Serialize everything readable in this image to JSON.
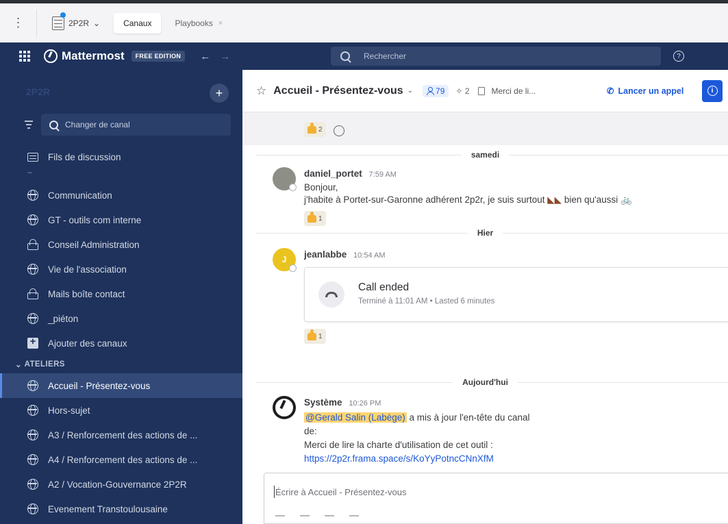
{
  "tabbar": {
    "team": "2P2R",
    "tabs": [
      {
        "label": "Canaux",
        "active": true
      },
      {
        "label": "Playbooks",
        "active": false,
        "close": "×"
      }
    ]
  },
  "global_header": {
    "product": "Mattermost",
    "edition_badge": "FREE EDITION",
    "back_icon": "←",
    "forward_icon": "→",
    "search_placeholder": "Rechercher",
    "help_icon": "?"
  },
  "sidebar": {
    "team_name": "2P2R",
    "add_icon": "+",
    "find_channel": "Changer de canal",
    "items": [
      {
        "label": "Fils de discussion",
        "icon": "threads-icon"
      },
      {
        "label": "Communication",
        "icon": "globe-icon"
      },
      {
        "label": "GT - outils com interne",
        "icon": "globe-icon"
      },
      {
        "label": "Conseil Administration",
        "icon": "lock-icon"
      },
      {
        "label": "Vie de l'association",
        "icon": "globe-icon"
      },
      {
        "label": "Mails boîte contact",
        "icon": "lock-icon"
      },
      {
        "label": "_piéton",
        "icon": "globe-icon"
      },
      {
        "label": "Ajouter des canaux",
        "icon": "add-box-icon"
      }
    ],
    "category": "ATELIERS",
    "category_items": [
      {
        "label": "Accueil - Présentez-vous",
        "active": true
      },
      {
        "label": "Hors-sujet"
      },
      {
        "label": "A3 / Renforcement des actions de ..."
      },
      {
        "label": "A4 / Renforcement des actions de ..."
      },
      {
        "label": "A2 / Vocation-Gouvernance 2P2R"
      },
      {
        "label": "Evenement Transtoulousaine"
      }
    ]
  },
  "channel_header": {
    "name": "Accueil - Présentez-vous",
    "member_count": "79",
    "pinned_count": "2",
    "purpose": "Merci de li...",
    "call_button": "Lancer un appel"
  },
  "messages": {
    "top_reaction": {
      "count": "2"
    },
    "separators": [
      "samedi",
      "Hier",
      "Aujourd'hui"
    ],
    "post1": {
      "author": "daniel_portet",
      "time": "7:59 AM",
      "lines": [
        "Bonjour,",
        "j'habite à Portet-sur-Garonne adhérent 2p2r, je suis surtout",
        "bien qu'aussi"
      ],
      "reaction_count": "1"
    },
    "post2": {
      "author": "jeanlabbe",
      "avatar_letter": "J",
      "time": "10:54 AM",
      "call_title": "Call ended",
      "call_subtitle": "Terminé à 11:01 AM • Lasted 6 minutes",
      "reaction_count": "1"
    },
    "post3": {
      "author": "Système",
      "time": "10:26 PM",
      "mention": "@Gerald Salin (Labège)",
      "action": " a mis à jour l'en-tête du canal",
      "line2": "de:",
      "line3": "Merci de lire la charte d'utilisation de cet outil :",
      "link": "https://2p2r.frama.space/s/KoYyPotncCNnXfM"
    }
  },
  "composer": {
    "placeholder": "Écrire à Accueil - Présentez-vous"
  }
}
